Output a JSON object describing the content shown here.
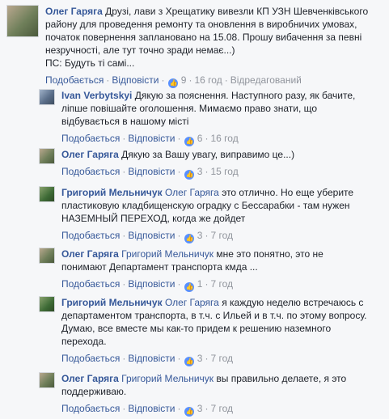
{
  "actions": {
    "like": "Подобається",
    "reply": "Відповісти",
    "edited": "Відредагований"
  },
  "main": {
    "author": "Олег Гаряга",
    "lines": [
      "Друзі, лави з Хрещатику вивезли КП УЗН Шевченківського",
      "району для проведення ремонту та оновлення в виробничих умовах,",
      "початок повернення заплановано на 15.08. Прошу вибачення за певні",
      "незручності, але тут точно зради немає...)",
      "ПС: Будуть ті самі..."
    ],
    "likes": "9",
    "time": "16 год"
  },
  "replies": [
    {
      "author": "Ivan Verbytskyi",
      "mention": "",
      "lines": [
        "Дякую за пояснення. Наступного разу, як бачите,",
        "ліпше повішайте оголошення. Мимаємо право знати, що",
        "відбувається в нашому місті"
      ],
      "likes": "6",
      "time": "16 год"
    },
    {
      "author": "Олег Гаряга",
      "mention": "",
      "lines": [
        "Дякую за Вашу увагу, виправимо це...)"
      ],
      "likes": "3",
      "time": "15 год"
    },
    {
      "author": "Григорий Мельничук",
      "mention": "Олег Гаряга",
      "lines": [
        "это отлично. Но еще уберите",
        "пластиковую кладбищенскую оградку с Бессарабки - там нужен",
        "НАЗЕМНЫЙ ПЕРЕХОД, когда же дойдет"
      ],
      "likes": "3",
      "time": "7 год"
    },
    {
      "author": "Олег Гаряга",
      "mention": "Григорий Мельничук",
      "lines": [
        "мне это понятно, это не",
        "понимают Департамент транспорта кмда ..."
      ],
      "likes": "1",
      "time": "7 год"
    },
    {
      "author": "Григорий Мельничук",
      "mention": "Олег Гаряга",
      "lines": [
        "я каждую неделю встречаюсь с",
        "департаментом транспорта, в т.ч. с Ильей и в т.ч. по этому вопросу.",
        "Думаю, все вместе мы как-то придем к решению наземного",
        "перехода."
      ],
      "likes": "3",
      "time": "7 год"
    },
    {
      "author": "Олег Гаряга",
      "mention": "Григорий Мельничук",
      "lines": [
        "вы правильно делаете, я это",
        "поддерживаю."
      ],
      "likes": "3",
      "time": "7 год"
    }
  ]
}
